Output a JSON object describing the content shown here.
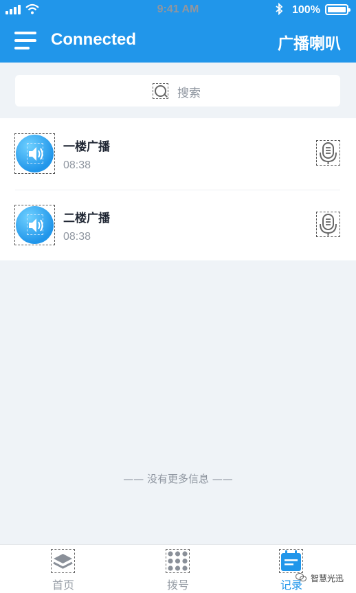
{
  "status_bar": {
    "time": "9:41 AM",
    "battery": "100%"
  },
  "header": {
    "title": "Connected",
    "right_label": "广播喇叭"
  },
  "search": {
    "placeholder": "搜索"
  },
  "broadcasts": [
    {
      "name": "一楼广播",
      "time": "08:38"
    },
    {
      "name": "二楼广播",
      "time": "08:38"
    }
  ],
  "footer_note": "—— 没有更多信息 ——",
  "tabs": [
    {
      "label": "首页",
      "icon": "layers-icon"
    },
    {
      "label": "拨号",
      "icon": "dialpad-icon"
    },
    {
      "label": "记录",
      "icon": "records-icon",
      "active": true
    }
  ],
  "watermark": "智慧光迅",
  "colors": {
    "primary": "#2196ea",
    "background": "#eff3f7",
    "muted_text": "#8f96a0"
  }
}
